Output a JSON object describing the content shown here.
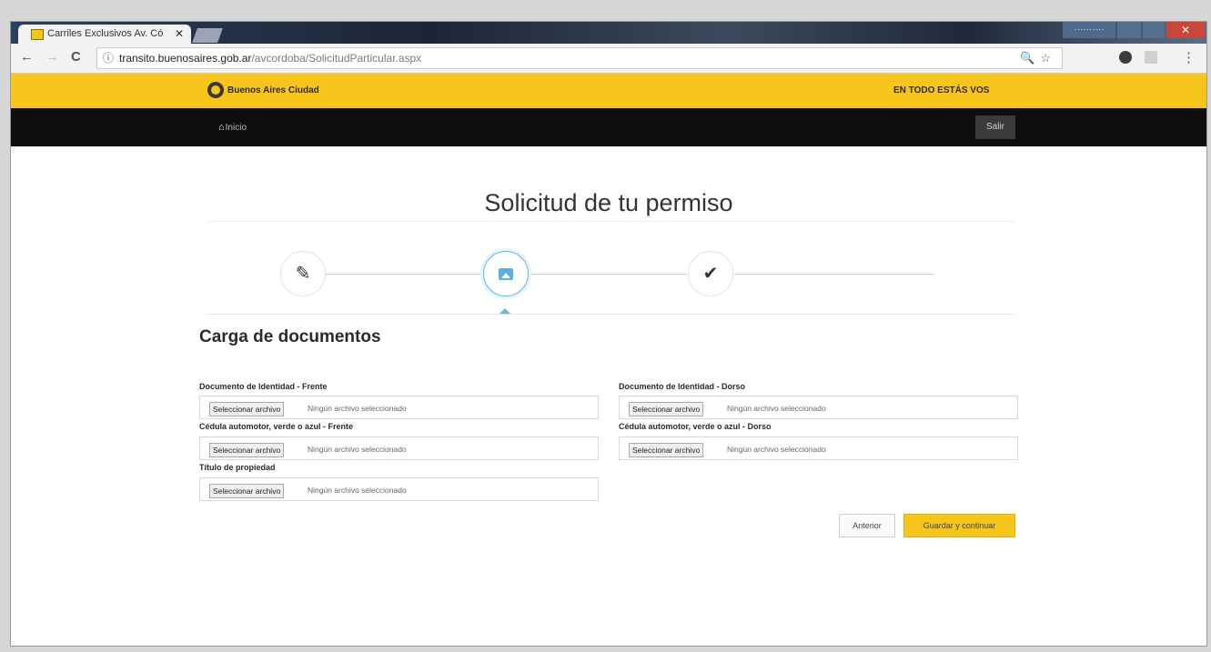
{
  "browser": {
    "tab_title": "Carriles Exclusivos Av. Có",
    "tab_close": "✕",
    "user_badge": "··········",
    "url_host": "transito.buenosaires.gob.ar",
    "url_path": "/avcordoba/SolicitudParticular.aspx",
    "nav": {
      "back": "←",
      "forward": "→",
      "reload": "C",
      "info": "ⓘ",
      "menu": "⋮",
      "tools": "🔍☆"
    }
  },
  "site": {
    "logo_text": "Buenos Aires Ciudad",
    "slogan": "EN TODO ESTÁS VOS",
    "home_link": "Inicio",
    "home_icon": "house-icon",
    "logout_label": "Salir"
  },
  "main": {
    "page_title": "Solicitud de tu permiso",
    "steps": [
      {
        "icon": "pencil-icon",
        "glyph": "✎",
        "state": "done"
      },
      {
        "icon": "image-icon",
        "glyph": "",
        "state": "active"
      },
      {
        "icon": "checkmark-icon",
        "glyph": "✔",
        "state": "pending"
      }
    ],
    "section_title": "Carga de documentos",
    "fields": [
      {
        "label": "Documento de Identidad - Frente",
        "button": "Seleccionar archivo",
        "status": "Ningún archivo seleccionado"
      },
      {
        "label": "Documento de Identidad - Dorso",
        "button": "Seleccionar archivo",
        "status": "Ningún archivo seleccionado"
      },
      {
        "label": "Cédula automotor, verde o azul - Frente",
        "button": "Seleccionar archivo",
        "status": "Ningún archivo seleccionado"
      },
      {
        "label": "Cédula automotor, verde o azul - Dorso",
        "button": "Seleccionar archivo",
        "status": "Ningún archivo seleccionado"
      },
      {
        "label": "Título de propiedad",
        "button": "Seleccionar archivo",
        "status": "Ningún archivo seleccionado"
      }
    ],
    "buttons": {
      "previous": "Anterior",
      "save_continue": "Guardar y continuar"
    }
  },
  "colors": {
    "brand_yellow": "#f7c51b",
    "nav_black": "#0e0e0e",
    "step_active": "#5aaee0"
  }
}
